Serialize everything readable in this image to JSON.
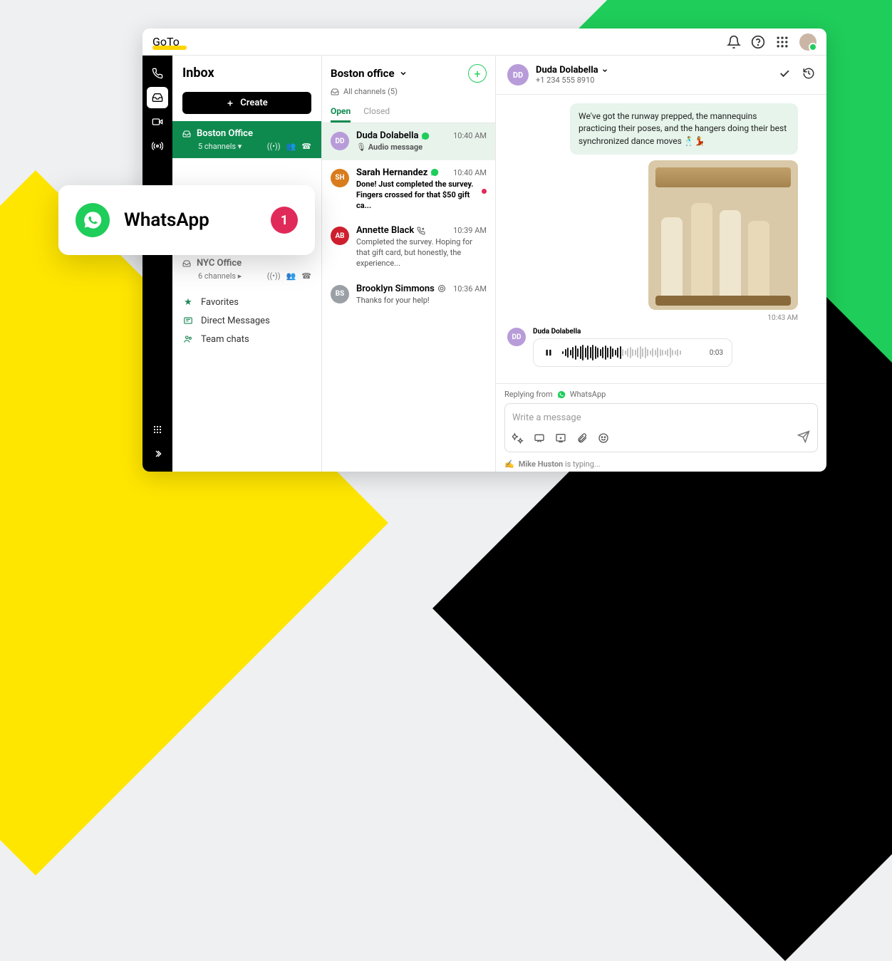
{
  "brand": {
    "logo_text": "GoTo"
  },
  "sidebar": {
    "inbox_title": "Inbox",
    "create_label": "Create",
    "offices": [
      {
        "name": "Boston Office",
        "channels": "5 channels",
        "active": true
      },
      {
        "name": "NYC Office",
        "channels": "6 channels",
        "active": false
      }
    ],
    "misc": [
      {
        "label": "Favorites"
      },
      {
        "label": "Direct Messages"
      },
      {
        "label": "Team chats"
      }
    ]
  },
  "conversations": {
    "title": "Boston office",
    "sub": "All channels (5)",
    "tabs": {
      "open": "Open",
      "closed": "Closed"
    },
    "items": [
      {
        "initials": "DD",
        "color": "#b89cd9",
        "name": "Duda Dolabella",
        "time": "10:40 AM",
        "snippet": "Audio message",
        "audio_icon": true,
        "selected": true
      },
      {
        "initials": "SH",
        "color": "#d97c1d",
        "name": "Sarah Hernandez",
        "time": "10:40 AM",
        "snippet": "Done! Just completed the survey. Fingers crossed for that $50 gift ca...",
        "unread": true
      },
      {
        "initials": "AB",
        "color": "#cf1f2e",
        "name": "Annette Black",
        "time": "10:39 AM",
        "snippet": "Completed the survey. Hoping for that gift card, but honestly, the experience..."
      },
      {
        "initials": "BS",
        "color": "#9aa0a6",
        "name": "Brooklyn Simmons",
        "time": "10:36 AM",
        "snippet": "Thanks for your help!"
      }
    ]
  },
  "chat": {
    "contact_name": "Duda Dolabella",
    "contact_initials": "DD",
    "contact_phone": "+1 234 555 8910",
    "bubble_text": "We've got the runway prepped, the mannequins practicing their poses, and the hangers doing their best synchronized dance moves 🕺💃",
    "image_ts": "10:43 AM",
    "audio_sender": "Duda Dolabella",
    "audio_sender_initials": "DD",
    "audio_duration": "0:03",
    "reply_from_label": "Replying from",
    "reply_channel": "WhatsApp",
    "compose_placeholder": "Write a message",
    "typing_user": "Mike Huston",
    "typing_suffix": " is typing..."
  },
  "floating": {
    "label": "WhatsApp",
    "badge": "1"
  }
}
